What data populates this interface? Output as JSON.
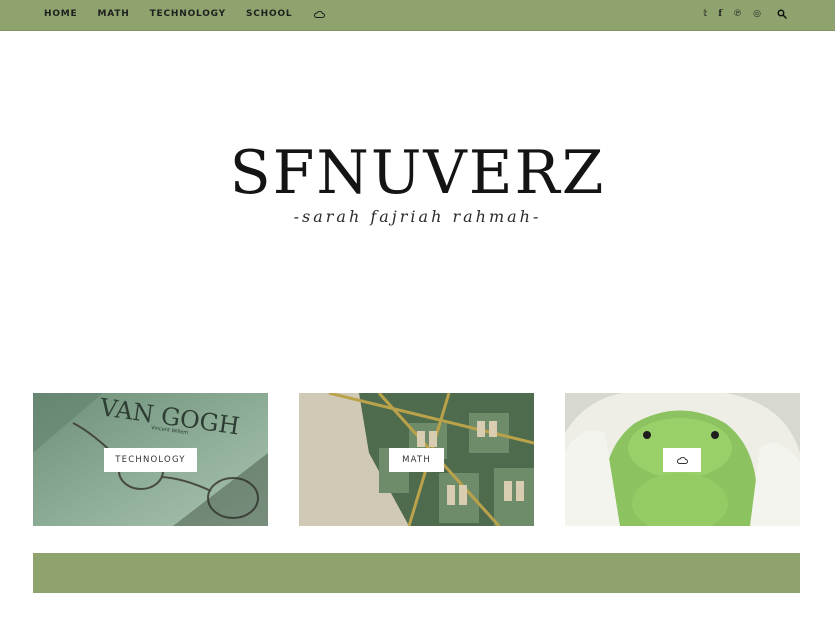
{
  "nav": {
    "items": [
      {
        "label": "HOME"
      },
      {
        "label": "MATH"
      },
      {
        "label": "TECHNOLOGY"
      },
      {
        "label": "SCHOOL"
      }
    ],
    "extra_icon": "cloud-icon"
  },
  "social": {
    "icons": [
      "twitter-icon",
      "facebook-icon",
      "pinterest-icon",
      "instagram-icon",
      "search-icon"
    ],
    "twitter_glyph": "𝕥",
    "facebook_glyph": "f",
    "pinterest_glyph": "℗",
    "instagram_glyph": "◎"
  },
  "header": {
    "title": "SFNUVERZ",
    "subtitle": "-sarah fajriah rahmah-"
  },
  "promos": [
    {
      "label": "TECHNOLOGY",
      "image_text": "VAN GOGH",
      "image_subtext": "Vincent Willem"
    },
    {
      "label": "MATH"
    },
    {
      "label_icon": "cloud-icon"
    }
  ],
  "colors": {
    "accent": "#8ea36d",
    "text": "#1f1f1f"
  }
}
